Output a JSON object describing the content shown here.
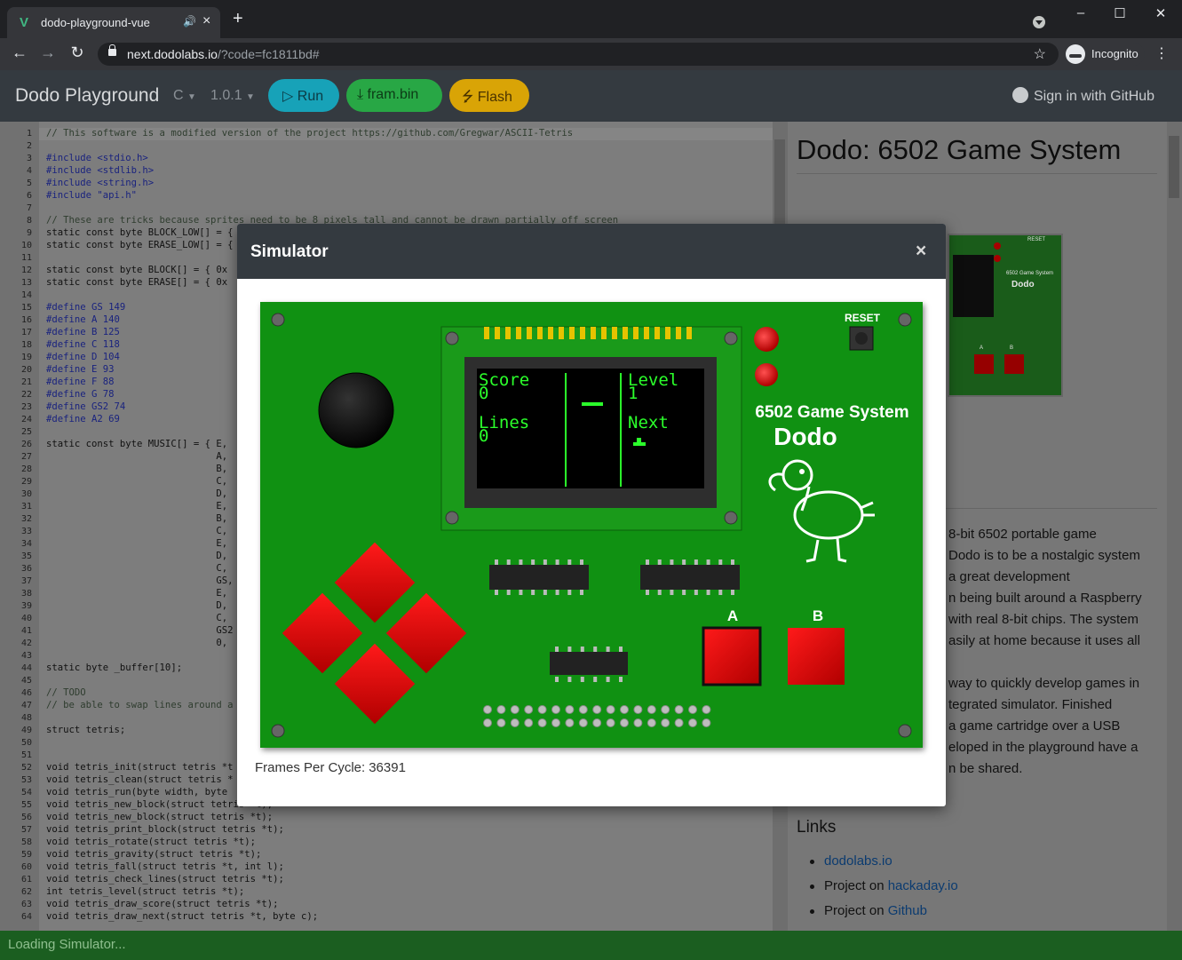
{
  "browser": {
    "tab_title": "dodo-playground-vue",
    "url_host": "next.dodolabs.io",
    "url_path": "/?code=fc1811bd#",
    "profile": "Incognito"
  },
  "navbar": {
    "brand": "Dodo Playground",
    "language": "C",
    "version": "1.0.1",
    "run": "Run",
    "fram": "fram.bin",
    "flash": "Flash",
    "signin": "Sign in with GitHub"
  },
  "editor": {
    "line_numbers": [
      "1",
      "2",
      "3",
      "4",
      "5",
      "6",
      "7",
      "8",
      "9",
      "10",
      "11",
      "12",
      "13",
      "14",
      "15",
      "16",
      "17",
      "18",
      "19",
      "20",
      "21",
      "22",
      "23",
      "24",
      "25",
      "26",
      "27",
      "28",
      "29",
      "30",
      "31",
      "32",
      "33",
      "34",
      "35",
      "36",
      "37",
      "38",
      "39",
      "40",
      "41",
      "42",
      "43",
      "44",
      "45",
      "46",
      "47",
      "48",
      "49",
      "50",
      "51",
      "52",
      "53",
      "54",
      "55",
      "56",
      "57",
      "58",
      "59",
      "60",
      "61",
      "62",
      "63",
      "64"
    ],
    "lines": [
      "// This software is a modified version of the project https://github.com/Gregwar/ASCII-Tetris",
      "",
      "#include <stdio.h>",
      "#include <stdlib.h>",
      "#include <string.h>",
      "#include \"api.h\"",
      "",
      "// These are tricks because sprites need to be 8 pixels tall and cannot be drawn partially off screen",
      "static const byte BLOCK_LOW[] = {",
      "static const byte ERASE_LOW[] = {",
      "",
      "static const byte BLOCK[] = { 0x",
      "static const byte ERASE[] = { 0x",
      "",
      "#define GS 149",
      "#define A 140",
      "#define B 125",
      "#define C 118",
      "#define D 104",
      "#define E 93",
      "#define F 88",
      "#define G 78",
      "#define GS2 74",
      "#define A2 69",
      "",
      "static const byte MUSIC[] = { E,",
      "                              A,",
      "                              B,",
      "                              C,",
      "                              D,",
      "                              E,",
      "                              B,",
      "                              C,",
      "                              E,",
      "                              D,",
      "                              C,",
      "                              GS,",
      "                              E,",
      "                              D,",
      "                              C,",
      "                              GS2",
      "                              0,",
      "",
      "static byte _buffer[10];",
      "",
      "// TODO",
      "// be able to swap lines around a",
      "",
      "struct tetris;",
      "",
      "",
      "void tetris_init(struct tetris *t",
      "void tetris_clean(struct tetris *",
      "void tetris_run(byte width, byte",
      "void tetris_new_block(struct tetris *t);",
      "void tetris_new_block(struct tetris *t);",
      "void tetris_print_block(struct tetris *t);",
      "void tetris_rotate(struct tetris *t);",
      "void tetris_gravity(struct tetris *t);",
      "void tetris_fall(struct tetris *t, int l);",
      "void tetris_check_lines(struct tetris *t);",
      "int tetris_level(struct tetris *t);",
      "void tetris_draw_score(struct tetris *t);",
      "void tetris_draw_next(struct tetris *t, byte c);"
    ]
  },
  "panel": {
    "title": "Dodo: 6502 Game System",
    "body_lines": [
      "8-bit 6502 portable game",
      "Dodo is to be a nostalgic system",
      "a great development",
      "n being built around a Raspberry",
      "with real 8-bit chips. The system",
      "asily at home because it uses all",
      "",
      "way to quickly develop games in",
      "tegrated simulator. Finished",
      "a game cartridge over a USB",
      "eloped in the playground have a",
      "n be shared."
    ],
    "links_heading": "Links",
    "links": [
      {
        "prefix": "",
        "text": "dodolabs.io"
      },
      {
        "prefix": "Project on ",
        "text": "hackaday.io"
      },
      {
        "prefix": "Project on ",
        "text": "Github"
      }
    ],
    "thumb_title": "6502 Game System",
    "thumb_name": "Dodo",
    "thumb_reset": "RESET",
    "thumb_a": "A",
    "thumb_b": "B"
  },
  "modal": {
    "title": "Simulator",
    "close": "×",
    "fps_label": "Frames Per Cycle:",
    "fps_value": "36391"
  },
  "device": {
    "reset_label": "RESET",
    "system_title": "6502 Game System",
    "name": "Dodo",
    "button_a": "A",
    "button_b": "B",
    "screen": {
      "score_label": "Score",
      "score_value": "0",
      "lines_label": "Lines",
      "lines_value": "0",
      "level_label": "Level",
      "level_value": "1",
      "next_label": "Next"
    }
  },
  "status": "Loading Simulator...",
  "colors": {
    "board": "#109112",
    "screen_text": "#2bff2b",
    "red_button": "#e00000"
  }
}
